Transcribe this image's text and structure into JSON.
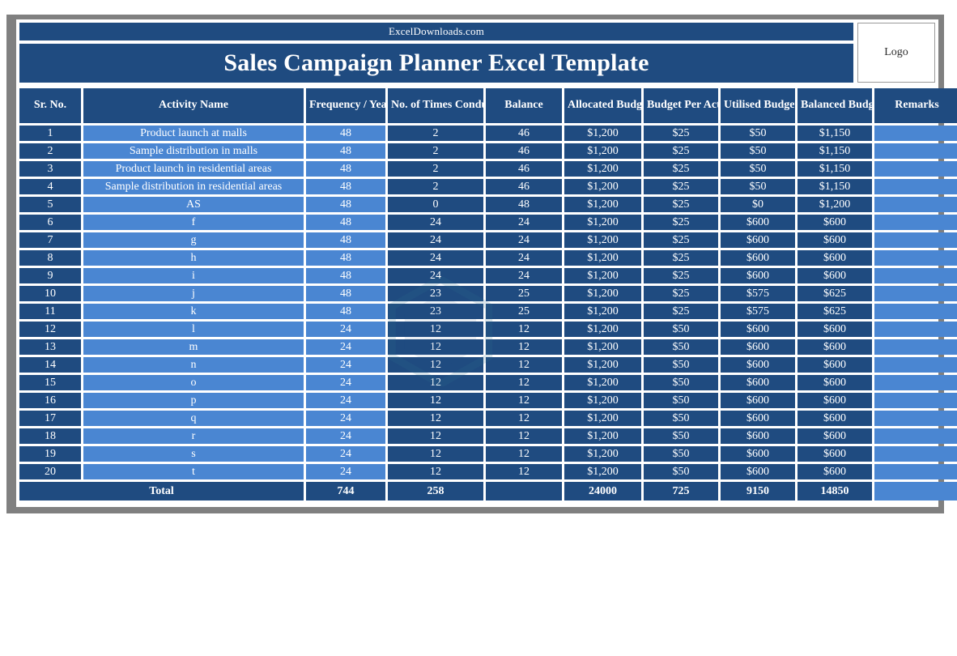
{
  "header": {
    "brand": "ExcelDownloads.com",
    "title": "Sales Campaign Planner Excel Template",
    "logo_label": "Logo"
  },
  "table": {
    "columns": [
      "Sr. No.",
      "Activity  Name",
      "Frequency / Year",
      "No. of Times Conducted",
      "Balance",
      "Allocated Budget",
      "Budget Per Activity",
      "Utilised Budget",
      "Balanced Budget",
      "Remarks"
    ],
    "rows": [
      {
        "sr": "1",
        "activity": "Product launch at malls",
        "frequency": "48",
        "times": "2",
        "balance": "46",
        "allocated": "$1,200",
        "per_activity": "$25",
        "utilised": "$50",
        "balanced": "$1,150",
        "remarks": ""
      },
      {
        "sr": "2",
        "activity": "Sample distribution in malls",
        "frequency": "48",
        "times": "2",
        "balance": "46",
        "allocated": "$1,200",
        "per_activity": "$25",
        "utilised": "$50",
        "balanced": "$1,150",
        "remarks": ""
      },
      {
        "sr": "3",
        "activity": "Product launch in residential areas",
        "frequency": "48",
        "times": "2",
        "balance": "46",
        "allocated": "$1,200",
        "per_activity": "$25",
        "utilised": "$50",
        "balanced": "$1,150",
        "remarks": ""
      },
      {
        "sr": "4",
        "activity": "Sample distribution in residential areas",
        "frequency": "48",
        "times": "2",
        "balance": "46",
        "allocated": "$1,200",
        "per_activity": "$25",
        "utilised": "$50",
        "balanced": "$1,150",
        "remarks": ""
      },
      {
        "sr": "5",
        "activity": "AS",
        "frequency": "48",
        "times": "0",
        "balance": "48",
        "allocated": "$1,200",
        "per_activity": "$25",
        "utilised": "$0",
        "balanced": "$1,200",
        "remarks": ""
      },
      {
        "sr": "6",
        "activity": "f",
        "frequency": "48",
        "times": "24",
        "balance": "24",
        "allocated": "$1,200",
        "per_activity": "$25",
        "utilised": "$600",
        "balanced": "$600",
        "remarks": ""
      },
      {
        "sr": "7",
        "activity": "g",
        "frequency": "48",
        "times": "24",
        "balance": "24",
        "allocated": "$1,200",
        "per_activity": "$25",
        "utilised": "$600",
        "balanced": "$600",
        "remarks": ""
      },
      {
        "sr": "8",
        "activity": "h",
        "frequency": "48",
        "times": "24",
        "balance": "24",
        "allocated": "$1,200",
        "per_activity": "$25",
        "utilised": "$600",
        "balanced": "$600",
        "remarks": ""
      },
      {
        "sr": "9",
        "activity": "i",
        "frequency": "48",
        "times": "24",
        "balance": "24",
        "allocated": "$1,200",
        "per_activity": "$25",
        "utilised": "$600",
        "balanced": "$600",
        "remarks": ""
      },
      {
        "sr": "10",
        "activity": "j",
        "frequency": "48",
        "times": "23",
        "balance": "25",
        "allocated": "$1,200",
        "per_activity": "$25",
        "utilised": "$575",
        "balanced": "$625",
        "remarks": ""
      },
      {
        "sr": "11",
        "activity": "k",
        "frequency": "48",
        "times": "23",
        "balance": "25",
        "allocated": "$1,200",
        "per_activity": "$25",
        "utilised": "$575",
        "balanced": "$625",
        "remarks": ""
      },
      {
        "sr": "12",
        "activity": "l",
        "frequency": "24",
        "times": "12",
        "balance": "12",
        "allocated": "$1,200",
        "per_activity": "$50",
        "utilised": "$600",
        "balanced": "$600",
        "remarks": ""
      },
      {
        "sr": "13",
        "activity": "m",
        "frequency": "24",
        "times": "12",
        "balance": "12",
        "allocated": "$1,200",
        "per_activity": "$50",
        "utilised": "$600",
        "balanced": "$600",
        "remarks": ""
      },
      {
        "sr": "14",
        "activity": "n",
        "frequency": "24",
        "times": "12",
        "balance": "12",
        "allocated": "$1,200",
        "per_activity": "$50",
        "utilised": "$600",
        "balanced": "$600",
        "remarks": ""
      },
      {
        "sr": "15",
        "activity": "o",
        "frequency": "24",
        "times": "12",
        "balance": "12",
        "allocated": "$1,200",
        "per_activity": "$50",
        "utilised": "$600",
        "balanced": "$600",
        "remarks": ""
      },
      {
        "sr": "16",
        "activity": "p",
        "frequency": "24",
        "times": "12",
        "balance": "12",
        "allocated": "$1,200",
        "per_activity": "$50",
        "utilised": "$600",
        "balanced": "$600",
        "remarks": ""
      },
      {
        "sr": "17",
        "activity": "q",
        "frequency": "24",
        "times": "12",
        "balance": "12",
        "allocated": "$1,200",
        "per_activity": "$50",
        "utilised": "$600",
        "balanced": "$600",
        "remarks": ""
      },
      {
        "sr": "18",
        "activity": "r",
        "frequency": "24",
        "times": "12",
        "balance": "12",
        "allocated": "$1,200",
        "per_activity": "$50",
        "utilised": "$600",
        "balanced": "$600",
        "remarks": ""
      },
      {
        "sr": "19",
        "activity": "s",
        "frequency": "24",
        "times": "12",
        "balance": "12",
        "allocated": "$1,200",
        "per_activity": "$50",
        "utilised": "$600",
        "balanced": "$600",
        "remarks": ""
      },
      {
        "sr": "20",
        "activity": "t",
        "frequency": "24",
        "times": "12",
        "balance": "12",
        "allocated": "$1,200",
        "per_activity": "$50",
        "utilised": "$600",
        "balanced": "$600",
        "remarks": ""
      }
    ],
    "total": {
      "label": "Total",
      "frequency": "744",
      "times": "258",
      "balance": "",
      "allocated": "24000",
      "per_activity": "725",
      "utilised": "9150",
      "balanced": "14850",
      "remarks": ""
    }
  },
  "colors": {
    "dark_blue": "#1F4B80",
    "light_blue": "#4A86D2",
    "frame_gray": "#808080",
    "text_white": "#FFFFFF"
  }
}
